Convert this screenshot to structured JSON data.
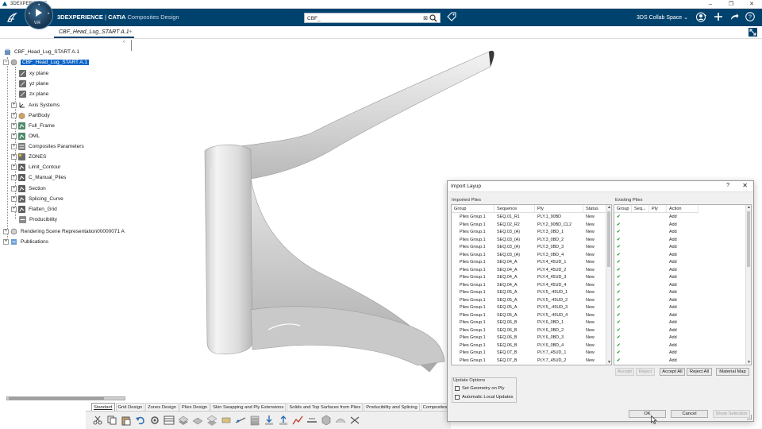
{
  "os": {
    "title": "3DEXPERIENCE",
    "controls": [
      "–",
      "❐",
      "✕"
    ]
  },
  "header": {
    "brand_bold": "3DEXPERIENCE",
    "brand_sep": " | ",
    "brand_catia": "CATIA",
    "app_name": "Composites Design",
    "compass_version": "V.R",
    "search_value": "CBF_",
    "collab_space": "3DS Collab Space",
    "colors": {
      "bar": "#00426e",
      "accent": "#0a64c8"
    }
  },
  "tabs": {
    "document": "CBF_Head_Lug_START A.1",
    "add": "+"
  },
  "tree": {
    "root": "CBF_Head_Lug_START A.1",
    "part": "CBF_Head_Lug_START A.1",
    "planes": [
      "xy plane",
      "yz plane",
      "zx plane"
    ],
    "items": [
      "Axis Systems",
      "PartBody",
      "Full_Frame",
      "OML",
      "Composites Parameters",
      "ZONES",
      "Limit_Contour",
      "C_Manual_Plies",
      "Section",
      "Splicing_Curve",
      "Flatten_Grid",
      "Producibility"
    ],
    "bottom": [
      "Rendering Scene Representation00000071 A",
      "Publications"
    ]
  },
  "section_tabs": [
    "Standard",
    "Grid Design",
    "Zones Design",
    "Plies Design",
    "Skin Swapping and Ply Extensions",
    "Solids and Top Surfaces from Plies",
    "Producibility and Splicing",
    "Composites"
  ],
  "dialog": {
    "title": "Import Layup",
    "help": "?",
    "close": "✕",
    "imported_label": "Imported Plies",
    "existing_label": "Existing Plies",
    "imported_headers": [
      "Group",
      "Sequence",
      "Ply",
      "Status"
    ],
    "existing_headers": [
      "Group",
      "Seq...",
      "Ply",
      "Action"
    ],
    "imported_rows": [
      [
        "Plies Group.1",
        "SEQ.01_R1",
        "PLY.1_90BD",
        "New"
      ],
      [
        "Plies Group.1",
        "SEQ.02_R2",
        "PLY.2_90BD_CL2",
        "New"
      ],
      [
        "Plies Group.1",
        "SEQ.03_(A)",
        "PLY.3_0BD_1",
        "New"
      ],
      [
        "Plies Group.1",
        "SEQ.03_(A)",
        "PLY.3_0BD_2",
        "New"
      ],
      [
        "Plies Group.1",
        "SEQ.03_(A)",
        "PLY.3_0BD_3",
        "New"
      ],
      [
        "Plies Group.1",
        "SEQ.03_(A)",
        "PLY.3_0BD_4",
        "New"
      ],
      [
        "Plies Group.1",
        "SEQ.04_A",
        "PLY.4_45UD_1",
        "New"
      ],
      [
        "Plies Group.1",
        "SEQ.04_A",
        "PLY.4_45UD_2",
        "New"
      ],
      [
        "Plies Group.1",
        "SEQ.04_A",
        "PLY.4_45UD_3",
        "New"
      ],
      [
        "Plies Group.1",
        "SEQ.04_A",
        "PLY.4_45UD_4",
        "New"
      ],
      [
        "Plies Group.1",
        "SEQ.05_A",
        "PLY.5_-45UD_1",
        "New"
      ],
      [
        "Plies Group.1",
        "SEQ.05_A",
        "PLY.5_-45UD_2",
        "New"
      ],
      [
        "Plies Group.1",
        "SEQ.05_A",
        "PLY.5_-45UD_3",
        "New"
      ],
      [
        "Plies Group.1",
        "SEQ.05_A",
        "PLY.5_-45UD_4",
        "New"
      ],
      [
        "Plies Group.1",
        "SEQ.06_B",
        "PLY.6_0BD_1",
        "New"
      ],
      [
        "Plies Group.1",
        "SEQ.06_B",
        "PLY.6_0BD_2",
        "New"
      ],
      [
        "Plies Group.1",
        "SEQ.06_B",
        "PLY.6_0BD_3",
        "New"
      ],
      [
        "Plies Group.1",
        "SEQ.06_B",
        "PLY.6_0BD_4",
        "New"
      ],
      [
        "Plies Group.1",
        "SEQ.07_B",
        "PLY.7_45UD_1",
        "New"
      ],
      [
        "Plies Group.1",
        "SEQ.07_B",
        "PLY.7_45UD_2",
        "New"
      ]
    ],
    "existing_action": "Add",
    "buttons_mid": {
      "accept": "Accept",
      "reject": "Reject",
      "accept_all": "Accept All",
      "reject_all": "Reject All",
      "material_map": "Material Map"
    },
    "update_options_label": "Update Options",
    "options": [
      "Set Geometry on Ply",
      "Automatic Local Updates"
    ],
    "buttons_bottom": {
      "ok": "OK",
      "cancel": "Cancel",
      "show_selection": "Show Selection"
    }
  }
}
